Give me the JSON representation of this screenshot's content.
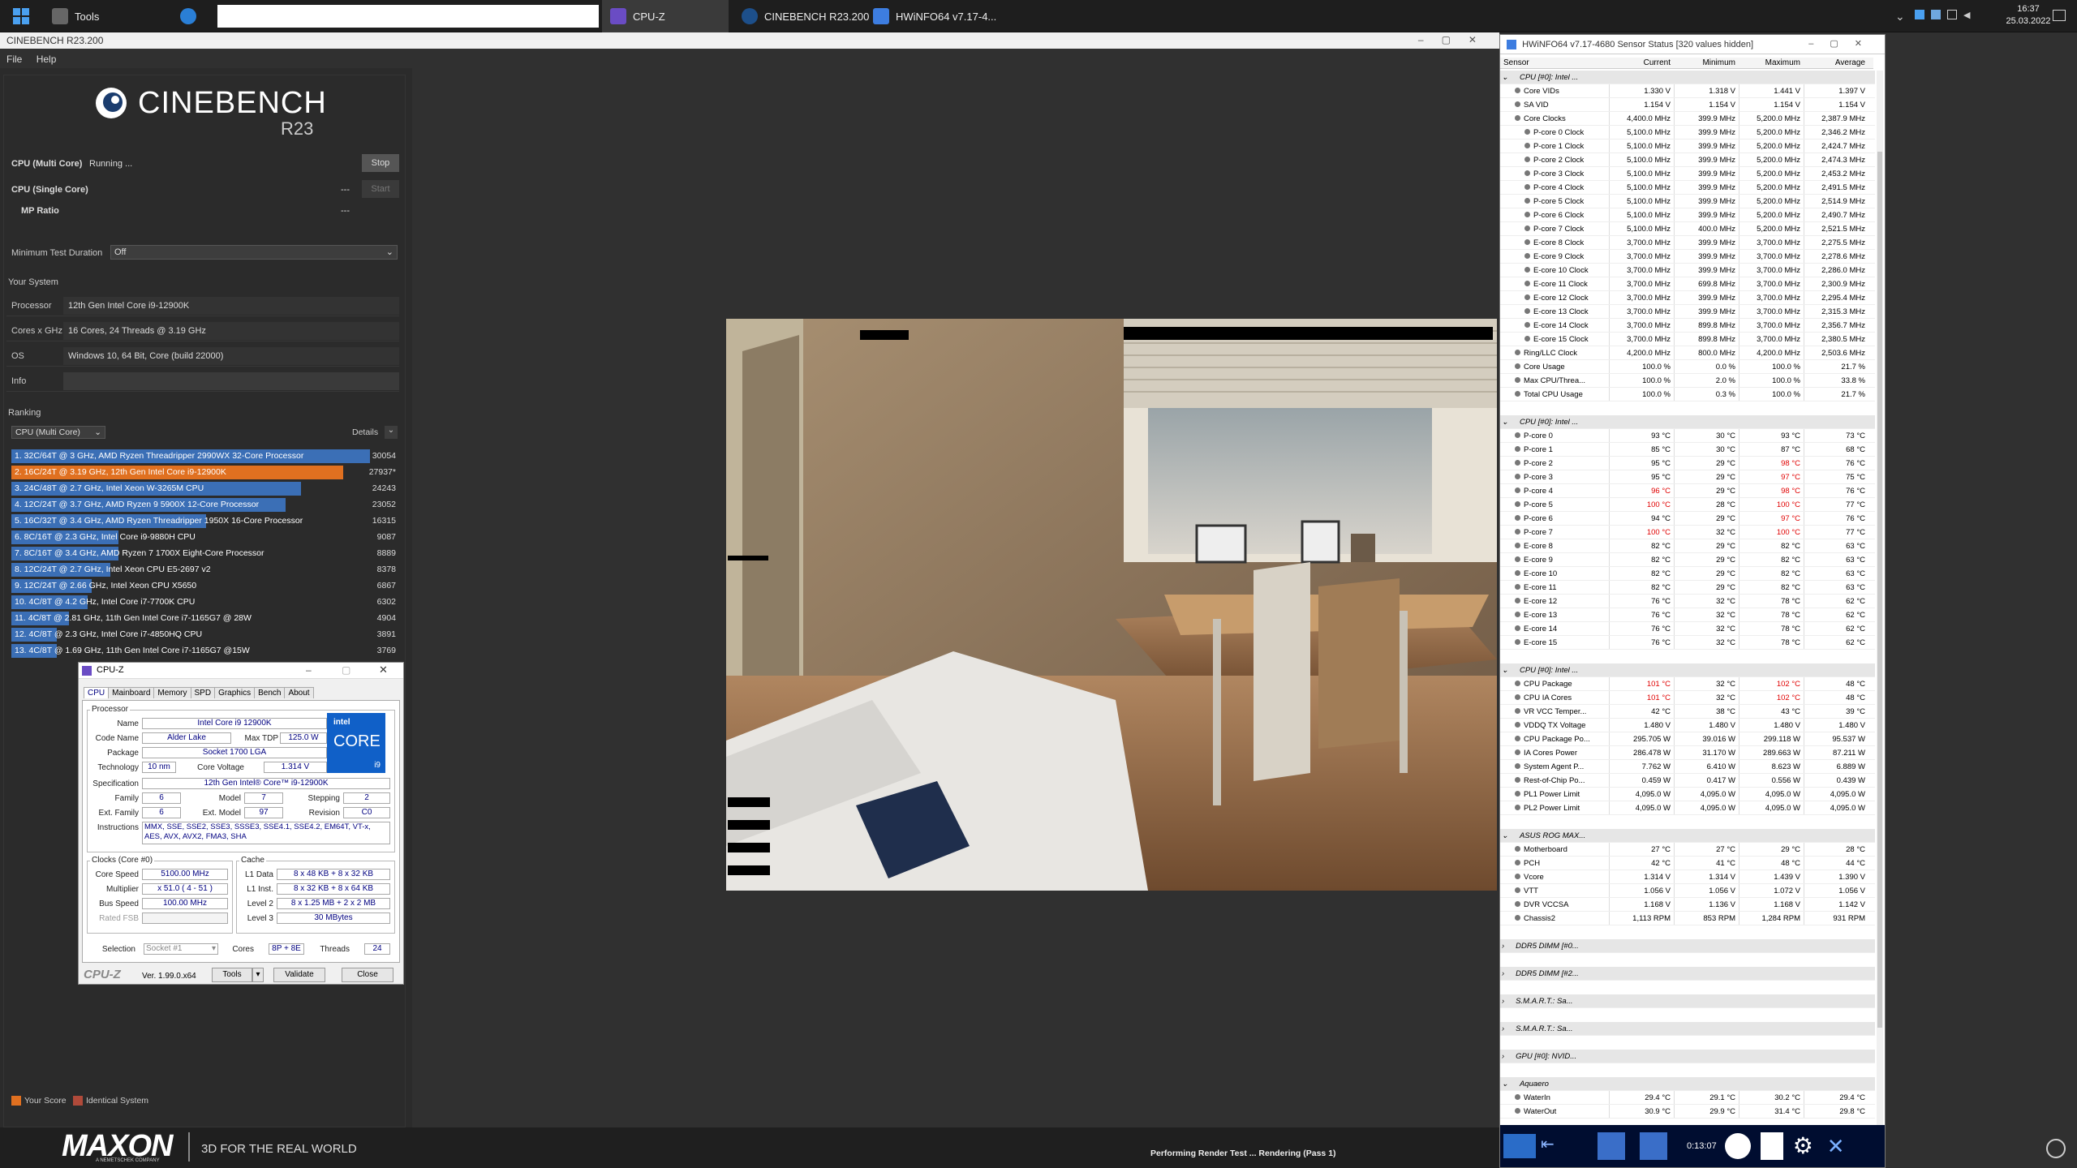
{
  "taskbar": {
    "items": [
      {
        "label": "Tools"
      },
      {
        "label": "CPU-Z"
      },
      {
        "label": "CINEBENCH R23.200"
      },
      {
        "label": "HWiNFO64 v7.17-4..."
      }
    ],
    "time": "16:37",
    "date": "25.03.2022"
  },
  "cinebench": {
    "window_title": "CINEBENCH R23.200",
    "menu": [
      "File",
      "Help"
    ],
    "logo_text": "CINEBENCH",
    "logo_version": "R23",
    "multi_core_label": "CPU (Multi Core)",
    "multi_core_status": "Running ...",
    "stop_label": "Stop",
    "single_core_label": "CPU (Single Core)",
    "single_core_value": "---",
    "start_label": "Start",
    "mp_ratio_label": "MP Ratio",
    "mp_ratio_value": "---",
    "min_duration_label": "Minimum Test Duration",
    "min_duration_value": "Off",
    "your_system_label": "Your System",
    "system": [
      {
        "label": "Processor",
        "value": "12th Gen Intel Core i9-12900K"
      },
      {
        "label": "Cores x GHz",
        "value": "16 Cores, 24 Threads @ 3.19 GHz"
      },
      {
        "label": "OS",
        "value": "Windows 10, 64 Bit, Core (build 22000)"
      },
      {
        "label": "Info",
        "value": ""
      }
    ],
    "ranking_label": "Ranking",
    "ranking_select": "CPU (Multi Core)",
    "details_label": "Details",
    "ranking": [
      {
        "text": "1. 32C/64T @ 3 GHz, AMD Ryzen Threadripper 2990WX 32-Core Processor",
        "score": "30054",
        "fill": 0.94,
        "highlight": false
      },
      {
        "text": "2. 16C/24T @ 3.19 GHz, 12th Gen Intel Core i9-12900K",
        "score": "27937*",
        "fill": 0.87,
        "highlight": true
      },
      {
        "text": "3. 24C/48T @ 2.7 GHz, Intel Xeon W-3265M CPU",
        "score": "24243",
        "fill": 0.76,
        "highlight": false
      },
      {
        "text": "4. 12C/24T @ 3.7 GHz, AMD Ryzen 9 5900X 12-Core Processor",
        "score": "23052",
        "fill": 0.72,
        "highlight": false
      },
      {
        "text": "5. 16C/32T @ 3.4 GHz, AMD Ryzen Threadripper 1950X 16-Core Processor",
        "score": "16315",
        "fill": 0.51,
        "highlight": false
      },
      {
        "text": "6. 8C/16T @ 2.3 GHz, Intel Core i9-9880H CPU",
        "score": "9087",
        "fill": 0.28,
        "highlight": false
      },
      {
        "text": "7. 8C/16T @ 3.4 GHz, AMD Ryzen 7 1700X Eight-Core Processor",
        "score": "8889",
        "fill": 0.28,
        "highlight": false
      },
      {
        "text": "8. 12C/24T @ 2.7 GHz, Intel Xeon CPU E5-2697 v2",
        "score": "8378",
        "fill": 0.26,
        "highlight": false
      },
      {
        "text": "9. 12C/24T @ 2.66 GHz, Intel Xeon CPU X5650",
        "score": "6867",
        "fill": 0.21,
        "highlight": false
      },
      {
        "text": "10. 4C/8T @ 4.2 GHz, Intel Core i7-7700K CPU",
        "score": "6302",
        "fill": 0.2,
        "highlight": false
      },
      {
        "text": "11. 4C/8T @ 2.81 GHz, 11th Gen Intel Core i7-1165G7 @ 28W",
        "score": "4904",
        "fill": 0.15,
        "highlight": false
      },
      {
        "text": "12. 4C/8T @ 2.3 GHz, Intel Core i7-4850HQ CPU",
        "score": "3891",
        "fill": 0.12,
        "highlight": false
      },
      {
        "text": "13. 4C/8T @ 1.69 GHz, 11th Gen Intel Core i7-1165G7 @15W",
        "score": "3769",
        "fill": 0.12,
        "highlight": false
      }
    ],
    "legend_your_score": "Your Score",
    "legend_identical": "Identical System",
    "maxon_brand": "MAXON",
    "maxon_sub": "A NEMETSCHEK COMPANY",
    "maxon_tagline": "3D FOR THE REAL WORLD",
    "status_text": "Performing Render Test ... Rendering (Pass 1)",
    "colors": {
      "bar": "#3b6fb6",
      "highlight": "#e07020",
      "your_score": "#e07020",
      "identical": "#b04a3a"
    }
  },
  "cpuz": {
    "title": "CPU-Z",
    "tabs": [
      "CPU",
      "Mainboard",
      "Memory",
      "SPD",
      "Graphics",
      "Bench",
      "About"
    ],
    "processor_label": "Processor",
    "name_label": "Name",
    "name": "Intel Core i9 12900K",
    "codename_label": "Code Name",
    "codename": "Alder Lake",
    "maxtdp_label": "Max TDP",
    "maxtdp": "125.0 W",
    "package_label": "Package",
    "package": "Socket 1700 LGA",
    "technology_label": "Technology",
    "technology": "10 nm",
    "corevoltage_label": "Core Voltage",
    "corevoltage": "1.314 V",
    "spec_label": "Specification",
    "spec": "12th Gen Intel® Core™ i9-12900K",
    "family_label": "Family",
    "family": "6",
    "model_label": "Model",
    "model": "7",
    "stepping_label": "Stepping",
    "stepping": "2",
    "extfamily_label": "Ext. Family",
    "extfamily": "6",
    "extmodel_label": "Ext. Model",
    "extmodel": "97",
    "revision_label": "Revision",
    "revision": "C0",
    "instr_label": "Instructions",
    "instr": "MMX, SSE, SSE2, SSE3, SSSE3, SSE4.1, SSE4.2, EM64T, VT-x, AES, AVX, AVX2, FMA3, SHA",
    "clocks_label": "Clocks (Core #0)",
    "corespeed_label": "Core Speed",
    "corespeed": "5100.00 MHz",
    "multiplier_label": "Multiplier",
    "multiplier": "x 51.0 ( 4 - 51 )",
    "busspeed_label": "Bus Speed",
    "busspeed": "100.00 MHz",
    "ratedfsb_label": "Rated FSB",
    "cache_label": "Cache",
    "l1d_label": "L1 Data",
    "l1d": "8 x 48 KB + 8 x 32 KB",
    "l1i_label": "L1 Inst.",
    "l1i": "8 x 32 KB + 8 x 64 KB",
    "l2_label": "Level 2",
    "l2": "8 x 1.25 MB + 2 x 2 MB",
    "l3_label": "Level 3",
    "l3": "30 MBytes",
    "selection_label": "Selection",
    "selection": "Socket #1",
    "cores_label": "Cores",
    "cores": "8P + 8E",
    "threads_label": "Threads",
    "threads": "24",
    "brand": "CPU-Z",
    "version": "Ver. 1.99.0.x64",
    "tools_label": "Tools",
    "validate_label": "Validate",
    "close_label": "Close",
    "intel_logo": "intel",
    "intel_core": "CORE",
    "intel_gen": "i9"
  },
  "hwinfo": {
    "title": "HWiNFO64 v7.17-4680 Sensor Status [320 values hidden]",
    "headers": [
      "Sensor",
      "Current",
      "Minimum",
      "Maximum",
      "Average"
    ],
    "timer": "0:13:07",
    "rows": [
      {
        "n": "CPU [#0]: Intel ...",
        "g": true
      },
      {
        "n": "Core VIDs",
        "c": "1.330 V",
        "m": "1.318 V",
        "x": "1.441 V",
        "a": "1.397 V",
        "i": 1
      },
      {
        "n": "SA VID",
        "c": "1.154 V",
        "m": "1.154 V",
        "x": "1.154 V",
        "a": "1.154 V",
        "i": 1
      },
      {
        "n": "Core Clocks",
        "c": "4,400.0 MHz",
        "m": "399.9 MHz",
        "x": "5,200.0 MHz",
        "a": "2,387.9 MHz",
        "i": 1
      },
      {
        "n": "P-core 0 Clock",
        "c": "5,100.0 MHz",
        "m": "399.9 MHz",
        "x": "5,200.0 MHz",
        "a": "2,346.2 MHz",
        "i": 2
      },
      {
        "n": "P-core 1 Clock",
        "c": "5,100.0 MHz",
        "m": "399.9 MHz",
        "x": "5,200.0 MHz",
        "a": "2,424.7 MHz",
        "i": 2
      },
      {
        "n": "P-core 2 Clock",
        "c": "5,100.0 MHz",
        "m": "399.9 MHz",
        "x": "5,200.0 MHz",
        "a": "2,474.3 MHz",
        "i": 2
      },
      {
        "n": "P-core 3 Clock",
        "c": "5,100.0 MHz",
        "m": "399.9 MHz",
        "x": "5,200.0 MHz",
        "a": "2,453.2 MHz",
        "i": 2
      },
      {
        "n": "P-core 4 Clock",
        "c": "5,100.0 MHz",
        "m": "399.9 MHz",
        "x": "5,200.0 MHz",
        "a": "2,491.5 MHz",
        "i": 2
      },
      {
        "n": "P-core 5 Clock",
        "c": "5,100.0 MHz",
        "m": "399.9 MHz",
        "x": "5,200.0 MHz",
        "a": "2,514.9 MHz",
        "i": 2
      },
      {
        "n": "P-core 6 Clock",
        "c": "5,100.0 MHz",
        "m": "399.9 MHz",
        "x": "5,200.0 MHz",
        "a": "2,490.7 MHz",
        "i": 2
      },
      {
        "n": "P-core 7 Clock",
        "c": "5,100.0 MHz",
        "m": "400.0 MHz",
        "x": "5,200.0 MHz",
        "a": "2,521.5 MHz",
        "i": 2
      },
      {
        "n": "E-core 8 Clock",
        "c": "3,700.0 MHz",
        "m": "399.9 MHz",
        "x": "3,700.0 MHz",
        "a": "2,275.5 MHz",
        "i": 2
      },
      {
        "n": "E-core 9 Clock",
        "c": "3,700.0 MHz",
        "m": "399.9 MHz",
        "x": "3,700.0 MHz",
        "a": "2,278.6 MHz",
        "i": 2
      },
      {
        "n": "E-core 10 Clock",
        "c": "3,700.0 MHz",
        "m": "399.9 MHz",
        "x": "3,700.0 MHz",
        "a": "2,286.0 MHz",
        "i": 2
      },
      {
        "n": "E-core 11 Clock",
        "c": "3,700.0 MHz",
        "m": "699.8 MHz",
        "x": "3,700.0 MHz",
        "a": "2,300.9 MHz",
        "i": 2
      },
      {
        "n": "E-core 12 Clock",
        "c": "3,700.0 MHz",
        "m": "399.9 MHz",
        "x": "3,700.0 MHz",
        "a": "2,295.4 MHz",
        "i": 2
      },
      {
        "n": "E-core 13 Clock",
        "c": "3,700.0 MHz",
        "m": "399.9 MHz",
        "x": "3,700.0 MHz",
        "a": "2,315.3 MHz",
        "i": 2
      },
      {
        "n": "E-core 14 Clock",
        "c": "3,700.0 MHz",
        "m": "899.8 MHz",
        "x": "3,700.0 MHz",
        "a": "2,356.7 MHz",
        "i": 2
      },
      {
        "n": "E-core 15 Clock",
        "c": "3,700.0 MHz",
        "m": "899.8 MHz",
        "x": "3,700.0 MHz",
        "a": "2,380.5 MHz",
        "i": 2
      },
      {
        "n": "Ring/LLC Clock",
        "c": "4,200.0 MHz",
        "m": "800.0 MHz",
        "x": "4,200.0 MHz",
        "a": "2,503.6 MHz",
        "i": 1
      },
      {
        "n": "Core Usage",
        "c": "100.0 %",
        "m": "0.0 %",
        "x": "100.0 %",
        "a": "21.7 %",
        "i": 1
      },
      {
        "n": "Max CPU/Threa...",
        "c": "100.0 %",
        "m": "2.0 %",
        "x": "100.0 %",
        "a": "33.8 %",
        "i": 1
      },
      {
        "n": "Total CPU Usage",
        "c": "100.0 %",
        "m": "0.3 %",
        "x": "100.0 %",
        "a": "21.7 %",
        "i": 1
      },
      {
        "n": "",
        "e": true
      },
      {
        "n": "CPU [#0]: Intel ...",
        "g": true
      },
      {
        "n": "P-core 0",
        "c": "93 °C",
        "m": "30 °C",
        "x": "93 °C",
        "a": "73 °C",
        "i": 1
      },
      {
        "n": "P-core 1",
        "c": "85 °C",
        "m": "30 °C",
        "x": "87 °C",
        "a": "68 °C",
        "i": 1
      },
      {
        "n": "P-core 2",
        "c": "95 °C",
        "m": "29 °C",
        "x": "98 °C",
        "a": "76 °C",
        "i": 1,
        "hx": true
      },
      {
        "n": "P-core 3",
        "c": "95 °C",
        "m": "29 °C",
        "x": "97 °C",
        "a": "75 °C",
        "i": 1,
        "hx": true
      },
      {
        "n": "P-core 4",
        "c": "96 °C",
        "m": "29 °C",
        "x": "98 °C",
        "a": "76 °C",
        "i": 1,
        "hc": true,
        "hx": true
      },
      {
        "n": "P-core 5",
        "c": "100 °C",
        "m": "28 °C",
        "x": "100 °C",
        "a": "77 °C",
        "i": 1,
        "hc": true,
        "hx": true
      },
      {
        "n": "P-core 6",
        "c": "94 °C",
        "m": "29 °C",
        "x": "97 °C",
        "a": "76 °C",
        "i": 1,
        "hx": true
      },
      {
        "n": "P-core 7",
        "c": "100 °C",
        "m": "32 °C",
        "x": "100 °C",
        "a": "77 °C",
        "i": 1,
        "hc": true,
        "hx": true
      },
      {
        "n": "E-core 8",
        "c": "82 °C",
        "m": "29 °C",
        "x": "82 °C",
        "a": "63 °C",
        "i": 1
      },
      {
        "n": "E-core 9",
        "c": "82 °C",
        "m": "29 °C",
        "x": "82 °C",
        "a": "63 °C",
        "i": 1
      },
      {
        "n": "E-core 10",
        "c": "82 °C",
        "m": "29 °C",
        "x": "82 °C",
        "a": "63 °C",
        "i": 1
      },
      {
        "n": "E-core 11",
        "c": "82 °C",
        "m": "29 °C",
        "x": "82 °C",
        "a": "63 °C",
        "i": 1
      },
      {
        "n": "E-core 12",
        "c": "76 °C",
        "m": "32 °C",
        "x": "78 °C",
        "a": "62 °C",
        "i": 1
      },
      {
        "n": "E-core 13",
        "c": "76 °C",
        "m": "32 °C",
        "x": "78 °C",
        "a": "62 °C",
        "i": 1
      },
      {
        "n": "E-core 14",
        "c": "76 °C",
        "m": "32 °C",
        "x": "78 °C",
        "a": "62 °C",
        "i": 1
      },
      {
        "n": "E-core 15",
        "c": "76 °C",
        "m": "32 °C",
        "x": "78 °C",
        "a": "62 °C",
        "i": 1
      },
      {
        "n": "",
        "e": true
      },
      {
        "n": "CPU [#0]: Intel ...",
        "g": true
      },
      {
        "n": "CPU Package",
        "c": "101 °C",
        "m": "32 °C",
        "x": "102 °C",
        "a": "48 °C",
        "i": 1,
        "hc": true,
        "hx": true
      },
      {
        "n": "CPU IA Cores",
        "c": "101 °C",
        "m": "32 °C",
        "x": "102 °C",
        "a": "48 °C",
        "i": 1,
        "hc": true,
        "hx": true
      },
      {
        "n": "VR VCC Temper...",
        "c": "42 °C",
        "m": "38 °C",
        "x": "43 °C",
        "a": "39 °C",
        "i": 1
      },
      {
        "n": "VDDQ TX Voltage",
        "c": "1.480 V",
        "m": "1.480 V",
        "x": "1.480 V",
        "a": "1.480 V",
        "i": 1
      },
      {
        "n": "CPU Package Po...",
        "c": "295.705 W",
        "m": "39.016 W",
        "x": "299.118 W",
        "a": "95.537 W",
        "i": 1
      },
      {
        "n": "IA Cores Power",
        "c": "286.478 W",
        "m": "31.170 W",
        "x": "289.663 W",
        "a": "87.211 W",
        "i": 1
      },
      {
        "n": "System Agent P...",
        "c": "7.762 W",
        "m": "6.410 W",
        "x": "8.623 W",
        "a": "6.889 W",
        "i": 1
      },
      {
        "n": "Rest-of-Chip Po...",
        "c": "0.459 W",
        "m": "0.417 W",
        "x": "0.556 W",
        "a": "0.439 W",
        "i": 1
      },
      {
        "n": "PL1 Power Limit",
        "c": "4,095.0 W",
        "m": "4,095.0 W",
        "x": "4,095.0 W",
        "a": "4,095.0 W",
        "i": 1
      },
      {
        "n": "PL2 Power Limit",
        "c": "4,095.0 W",
        "m": "4,095.0 W",
        "x": "4,095.0 W",
        "a": "4,095.0 W",
        "i": 1
      },
      {
        "n": "",
        "e": true
      },
      {
        "n": "ASUS ROG MAX...",
        "g": true
      },
      {
        "n": "Motherboard",
        "c": "27 °C",
        "m": "27 °C",
        "x": "29 °C",
        "a": "28 °C",
        "i": 1
      },
      {
        "n": "PCH",
        "c": "42 °C",
        "m": "41 °C",
        "x": "48 °C",
        "a": "44 °C",
        "i": 1
      },
      {
        "n": "Vcore",
        "c": "1.314 V",
        "m": "1.314 V",
        "x": "1.439 V",
        "a": "1.390 V",
        "i": 1
      },
      {
        "n": "VTT",
        "c": "1.056 V",
        "m": "1.056 V",
        "x": "1.072 V",
        "a": "1.056 V",
        "i": 1
      },
      {
        "n": "DVR VCCSA",
        "c": "1.168 V",
        "m": "1.136 V",
        "x": "1.168 V",
        "a": "1.142 V",
        "i": 1
      },
      {
        "n": "Chassis2",
        "c": "1,113 RPM",
        "m": "853 RPM",
        "x": "1,284 RPM",
        "a": "931 RPM",
        "i": 1
      },
      {
        "n": "",
        "e": true
      },
      {
        "n": "DDR5 DIMM [#0...",
        "g": true,
        "col": true
      },
      {
        "n": "",
        "e": true
      },
      {
        "n": "DDR5 DIMM [#2...",
        "g": true,
        "col": true
      },
      {
        "n": "",
        "e": true
      },
      {
        "n": "S.M.A.R.T.: Sa...",
        "g": true,
        "col": true
      },
      {
        "n": "",
        "e": true
      },
      {
        "n": "S.M.A.R.T.: Sa...",
        "g": true,
        "col": true
      },
      {
        "n": "",
        "e": true
      },
      {
        "n": "GPU [#0]: NVID...",
        "g": true,
        "col": true
      },
      {
        "n": "",
        "e": true
      },
      {
        "n": "Aquaero",
        "g": true
      },
      {
        "n": "WaterIn",
        "c": "29.4 °C",
        "m": "29.1 °C",
        "x": "30.2 °C",
        "a": "29.4 °C",
        "i": 1
      },
      {
        "n": "WaterOut",
        "c": "30.9 °C",
        "m": "29.9 °C",
        "x": "31.4 °C",
        "a": "29.8 °C",
        "i": 1
      }
    ]
  }
}
